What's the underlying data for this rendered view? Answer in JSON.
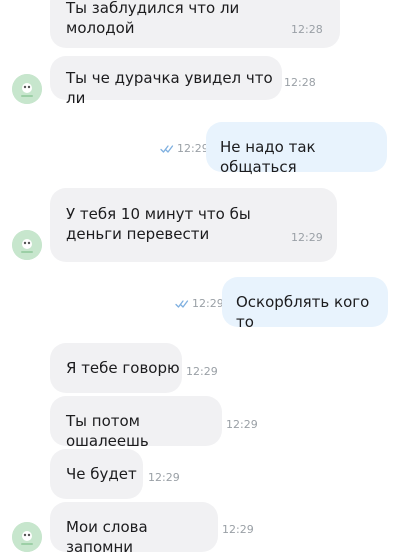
{
  "messages": [
    {
      "text": "Ты заблудился что ли\nмолодой",
      "time": "12:28",
      "direction": "in"
    },
    {
      "text": "Ты че дурачка увидел что ли",
      "time": "12:28",
      "direction": "in"
    },
    {
      "text": "Не надо так общаться",
      "time": "12:29",
      "direction": "out"
    },
    {
      "text": "У тебя 10 минут что бы\nденьги перевести",
      "time": "12:29",
      "direction": "in"
    },
    {
      "text": "Оскорблять кого то",
      "time": "12:29",
      "direction": "out"
    },
    {
      "text": "Я тебе говорю",
      "time": "12:29",
      "direction": "in"
    },
    {
      "text": "Ты потом ошалеешь",
      "time": "12:29",
      "direction": "in"
    },
    {
      "text": "Че будет",
      "time": "12:29",
      "direction": "in"
    },
    {
      "text": "Мои слова запомни",
      "time": "12:29",
      "direction": "in"
    }
  ],
  "icons": {
    "read_status": "double-check-icon",
    "avatar": "contact-avatar"
  },
  "colors": {
    "incoming_bubble": "#f1f1f3",
    "outgoing_bubble": "#e8f3fd",
    "read_check": "#7fb0e0",
    "timestamp": "#9aa0a6"
  }
}
